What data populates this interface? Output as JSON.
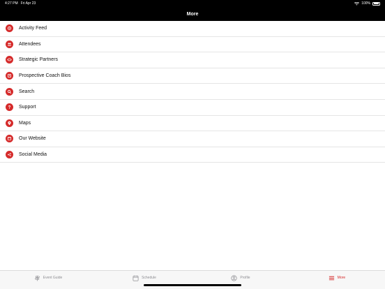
{
  "status": {
    "time": "4:27 PM",
    "date": "Fri Apr 23",
    "battery": "100%"
  },
  "header": {
    "title": "More"
  },
  "menu": [
    {
      "label": "Activity Feed"
    },
    {
      "label": "Attendees"
    },
    {
      "label": "Strategic Partners"
    },
    {
      "label": "Prospective Coach Bios"
    },
    {
      "label": "Search"
    },
    {
      "label": "Support"
    },
    {
      "label": "Maps"
    },
    {
      "label": "Our Website"
    },
    {
      "label": "Social Media"
    }
  ],
  "tabs": [
    {
      "label": "Event Guide",
      "icon": "signpost-icon"
    },
    {
      "label": "Schedule",
      "icon": "calendar-icon"
    },
    {
      "label": "Profile",
      "icon": "person-icon"
    },
    {
      "label": "More",
      "icon": "hamburger-icon"
    }
  ],
  "colors": {
    "accent": "#d52b2b",
    "header_bg": "#000000"
  }
}
